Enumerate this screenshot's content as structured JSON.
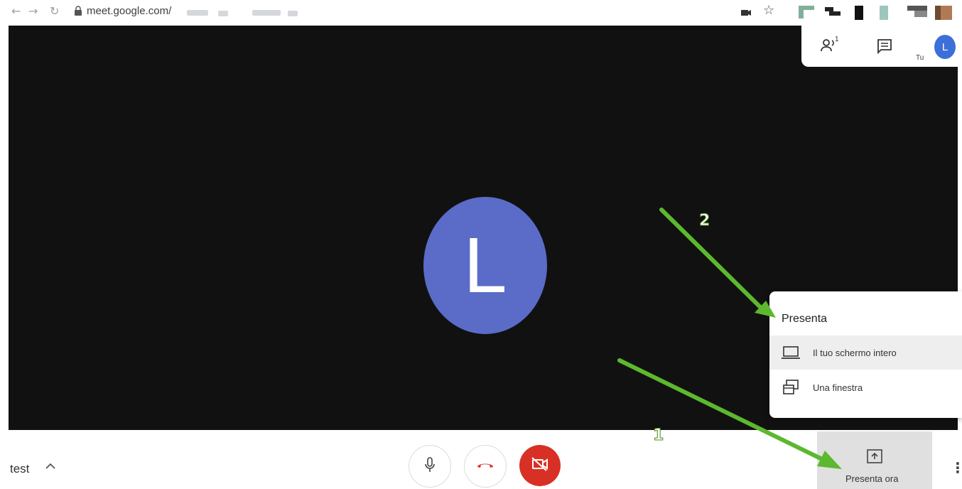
{
  "browser": {
    "url": "meet.google.com/",
    "nav_icons": [
      "back-icon",
      "forward-icon",
      "reload-icon",
      "lock-icon"
    ],
    "action_icons": [
      "cast-icon",
      "star-icon"
    ]
  },
  "header": {
    "you_label": "Tu",
    "avatar_letter": "L",
    "icons": [
      "people-icon",
      "chat-icon"
    ],
    "participant_count": "1"
  },
  "stage": {
    "avatar_letter": "L",
    "background": "#111111",
    "avatar_color": "#5b6bc8"
  },
  "present_menu": {
    "title": "Presenta",
    "items": [
      {
        "label": "Il tuo schermo intero",
        "icon": "laptop-icon"
      },
      {
        "label": "Una finestra",
        "icon": "window-icon"
      }
    ]
  },
  "bottom": {
    "meeting_name": "test",
    "present_label": "Presenta ora",
    "controls": [
      "mic-icon",
      "hangup-icon",
      "camera-off-icon"
    ],
    "hangup_color": "#d93025"
  },
  "annotations": {
    "step1": "1",
    "step2": "2",
    "arrow_color": "#5cb82e"
  }
}
